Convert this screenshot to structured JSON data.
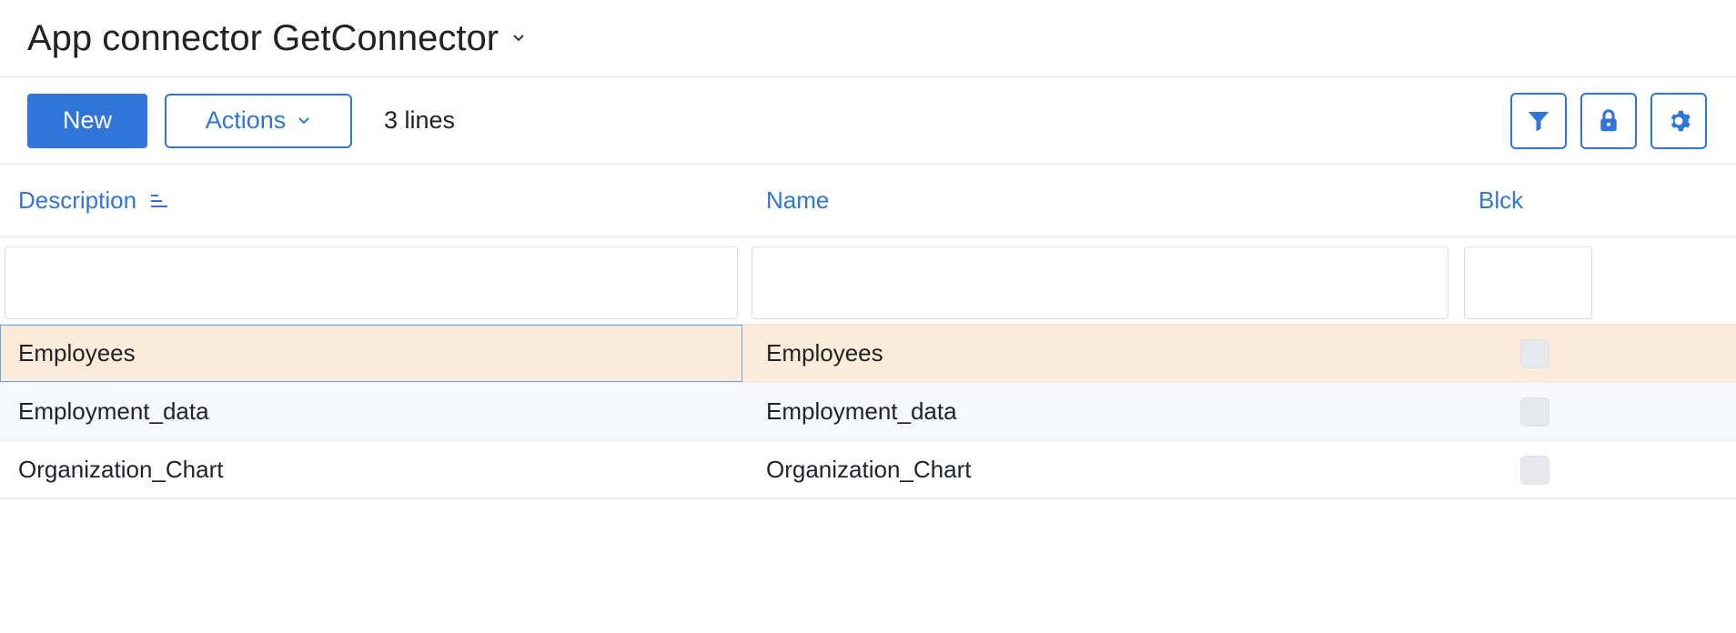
{
  "window": {
    "title": "App connector GetConnector"
  },
  "toolbar": {
    "new_label": "New",
    "actions_label": "Actions",
    "line_count": "3 lines",
    "icons": [
      "filter-icon",
      "lock-icon",
      "gear-icon"
    ]
  },
  "table": {
    "columns": [
      {
        "label": "Description",
        "sorted": "ascending"
      },
      {
        "label": "Name"
      },
      {
        "label": "Blck"
      }
    ],
    "filters": {
      "description": "",
      "name": "",
      "blck": ""
    },
    "rows": [
      {
        "description": "Employees",
        "name": "Employees",
        "blck": false,
        "state": "selected"
      },
      {
        "description": "Employment_data",
        "name": "Employment_data",
        "blck": false,
        "state": "normal"
      },
      {
        "description": "Organization_Chart",
        "name": "Organization_Chart",
        "blck": false,
        "state": "normal"
      }
    ]
  },
  "colors": {
    "accent": "#2f76d8",
    "selected_row": "#fcebd9",
    "alt_row": "#f7f8fa"
  }
}
